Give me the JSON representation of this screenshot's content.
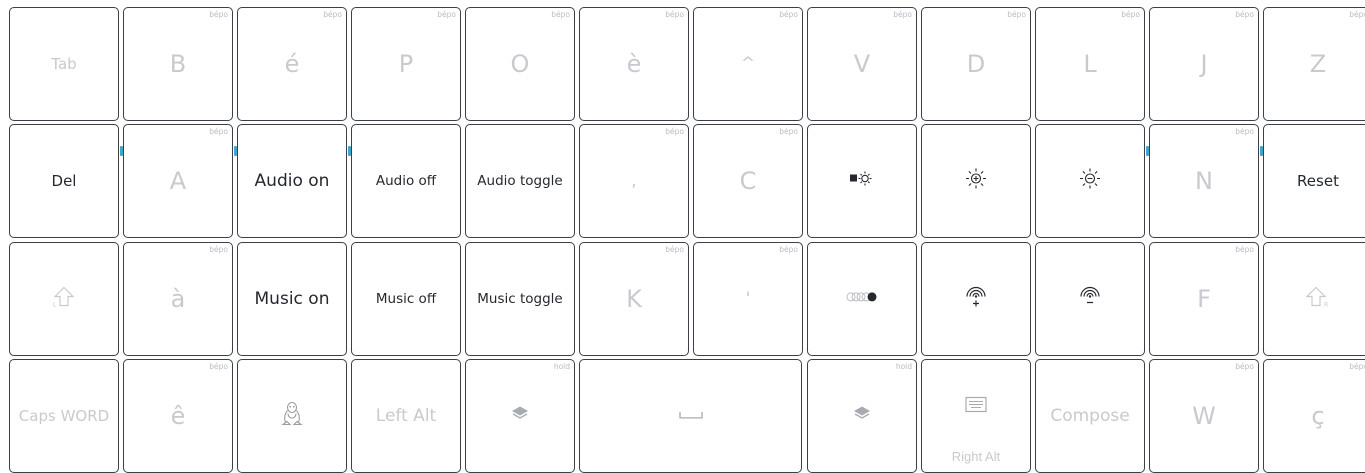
{
  "keyboard": {
    "rows": [
      [
        {
          "id": "tab",
          "label": "Tab",
          "hint": "",
          "style": "dim",
          "size": "sm"
        },
        {
          "id": "b",
          "label": "B",
          "hint": "bépo",
          "style": "dim",
          "size": "lg"
        },
        {
          "id": "e-acute",
          "label": "é",
          "hint": "bépo",
          "style": "dim",
          "size": "lg"
        },
        {
          "id": "p",
          "label": "P",
          "hint": "bépo",
          "style": "dim",
          "size": "lg"
        },
        {
          "id": "o",
          "label": "O",
          "hint": "bépo",
          "style": "dim",
          "size": "lg"
        },
        {
          "id": "e-grave",
          "label": "è",
          "hint": "bépo",
          "style": "dim",
          "size": "lg"
        },
        {
          "id": "circumflex",
          "label": "^",
          "hint": "bépo",
          "style": "dim",
          "size": "md"
        },
        {
          "id": "v",
          "label": "V",
          "hint": "bépo",
          "style": "dim",
          "size": "lg"
        },
        {
          "id": "d",
          "label": "D",
          "hint": "bépo",
          "style": "dim",
          "size": "lg"
        },
        {
          "id": "l",
          "label": "L",
          "hint": "bépo",
          "style": "dim",
          "size": "lg"
        },
        {
          "id": "j",
          "label": "J",
          "hint": "bépo",
          "style": "dim",
          "size": "lg"
        },
        {
          "id": "z",
          "label": "Z",
          "hint": "bépo",
          "style": "dim",
          "size": "lg"
        }
      ],
      [
        {
          "id": "del",
          "label": "Del",
          "hint": "",
          "style": "dark",
          "size": "sm"
        },
        {
          "id": "a",
          "label": "A",
          "hint": "bépo",
          "style": "dim",
          "size": "lg"
        },
        {
          "id": "audio-on",
          "label": "Audio on",
          "hint": "",
          "style": "dark",
          "size": "md"
        },
        {
          "id": "audio-off",
          "label": "Audio off",
          "hint": "",
          "style": "dark",
          "size": "xs"
        },
        {
          "id": "audio-toggle",
          "label": "Audio toggle",
          "hint": "",
          "style": "dark",
          "size": "xs"
        },
        {
          "id": "comma",
          "label": ",",
          "hint": "bépo",
          "style": "dim",
          "size": "md"
        },
        {
          "id": "c",
          "label": "C",
          "hint": "bépo",
          "style": "dim",
          "size": "lg"
        },
        {
          "id": "backlight-toggle",
          "label": "",
          "icon": "backlight-toggle-icon",
          "hint": "",
          "style": "dark"
        },
        {
          "id": "brightness-up",
          "label": "",
          "icon": "brightness-up-icon",
          "hint": "",
          "style": "dark"
        },
        {
          "id": "brightness-down",
          "label": "",
          "icon": "brightness-down-icon",
          "hint": "",
          "style": "dark"
        },
        {
          "id": "n",
          "label": "N",
          "hint": "bépo",
          "style": "dim",
          "size": "lg"
        },
        {
          "id": "reset",
          "label": "Reset",
          "hint": "",
          "style": "dark",
          "size": "sm"
        }
      ],
      [
        {
          "id": "left-shift",
          "label": "",
          "icon": "left-shift-icon",
          "hint": "",
          "style": "dim"
        },
        {
          "id": "a-grave",
          "label": "à",
          "hint": "bépo",
          "style": "dim",
          "size": "lg"
        },
        {
          "id": "music-on",
          "label": "Music on",
          "hint": "",
          "style": "dark",
          "size": "md"
        },
        {
          "id": "music-off",
          "label": "Music off",
          "hint": "",
          "style": "dark",
          "size": "xs"
        },
        {
          "id": "music-toggle",
          "label": "Music toggle",
          "hint": "",
          "style": "dark",
          "size": "xs"
        },
        {
          "id": "k",
          "label": "K",
          "hint": "bépo",
          "style": "dim",
          "size": "lg"
        },
        {
          "id": "apostrophe",
          "label": "'",
          "hint": "bépo",
          "style": "dim",
          "size": "md"
        },
        {
          "id": "rgb-mode",
          "label": "",
          "icon": "rgb-mode-icon",
          "hint": "",
          "style": "dark"
        },
        {
          "id": "signal-up",
          "label": "",
          "icon": "signal-up-icon",
          "hint": "",
          "style": "dark"
        },
        {
          "id": "signal-down",
          "label": "",
          "icon": "signal-down-icon",
          "hint": "",
          "style": "dark"
        },
        {
          "id": "f",
          "label": "F",
          "hint": "bépo",
          "style": "dim",
          "size": "lg"
        },
        {
          "id": "right-shift",
          "label": "",
          "icon": "right-shift-icon",
          "hint": "",
          "style": "dim"
        }
      ],
      [
        {
          "id": "caps-word",
          "label": "Caps WORD",
          "hint": "",
          "style": "dim",
          "size": "sm"
        },
        {
          "id": "e-circumflex",
          "label": "ê",
          "hint": "bépo",
          "style": "dim",
          "size": "lg"
        },
        {
          "id": "linux",
          "label": "",
          "icon": "linux-icon",
          "hint": "",
          "style": "dim"
        },
        {
          "id": "left-alt",
          "label": "Left Alt",
          "hint": "",
          "style": "dim",
          "size": "md"
        },
        {
          "id": "layer-left",
          "label": "",
          "icon": "layers-icon",
          "hint": "hold",
          "style": "dim"
        },
        {
          "id": "space",
          "label": "",
          "icon": "space-icon",
          "hint": "",
          "style": "dim",
          "wide": true
        },
        {
          "id": "layer-right",
          "label": "",
          "icon": "layers-icon",
          "hint": "hold",
          "style": "dim"
        },
        {
          "id": "right-alt",
          "label": "",
          "icon": "keyboard-icon",
          "sub": "Right Alt",
          "hint": "",
          "style": "dim"
        },
        {
          "id": "compose",
          "label": "Compose",
          "hint": "",
          "style": "dim",
          "size": "md"
        },
        {
          "id": "w",
          "label": "W",
          "hint": "bépo",
          "style": "dim",
          "size": "lg"
        },
        {
          "id": "c-cedilla",
          "label": "ç",
          "hint": "bépo",
          "style": "dim",
          "size": "lg"
        }
      ]
    ]
  },
  "colors": {
    "border": "#3b3f47",
    "dim_text": "#c8cad0",
    "dark_text": "#25282f",
    "hint": "#b9bcc2",
    "accent": "#3ea6c9"
  }
}
